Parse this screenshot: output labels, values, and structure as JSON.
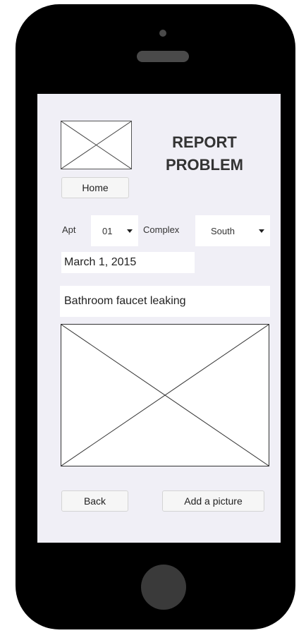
{
  "header": {
    "title": "REPORT PROBLEM"
  },
  "nav": {
    "home_label": "Home"
  },
  "form": {
    "apt_label": "Apt",
    "apt_value": "01",
    "complex_label": "Complex",
    "complex_value": "South",
    "date_value": "March 1, 2015",
    "description_value": "Bathroom faucet leaking"
  },
  "actions": {
    "back_label": "Back",
    "add_picture_label": "Add a picture"
  },
  "icons": {
    "logo": "image-placeholder-icon",
    "photo": "image-placeholder-icon",
    "dropdown": "chevron-down-icon"
  }
}
